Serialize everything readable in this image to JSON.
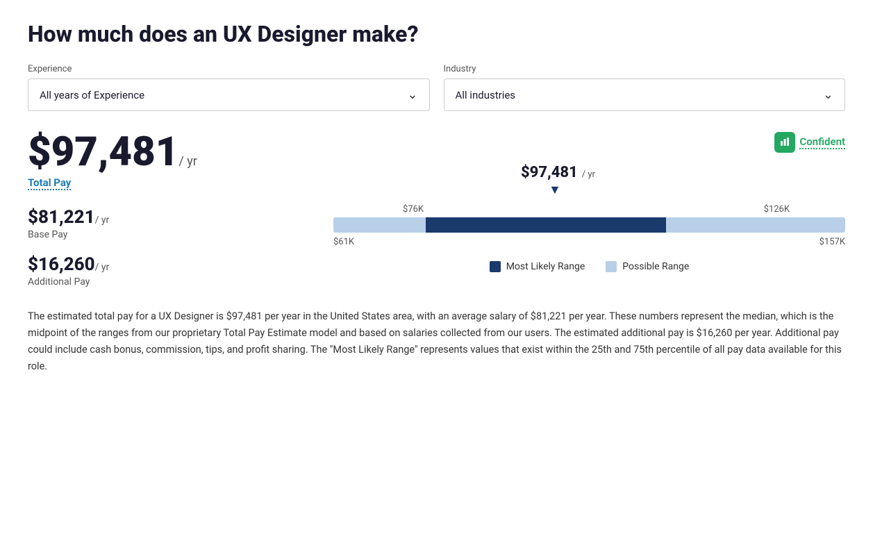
{
  "page": {
    "title": "How much does an UX Designer make?"
  },
  "filters": {
    "experience_label": "Experience",
    "experience_value": "All years of Experience",
    "industry_label": "Industry",
    "industry_value": "All industries"
  },
  "salary": {
    "total_pay_amount": "$97,481",
    "total_pay_suffix": "/ yr",
    "total_pay_label": "Total Pay",
    "base_pay_amount": "$81,221",
    "base_pay_suffix": "/ yr",
    "base_pay_label": "Base Pay",
    "additional_pay_amount": "$16,260",
    "additional_pay_suffix": "/ yr",
    "additional_pay_label": "Additional Pay",
    "median_amount": "$97,481",
    "median_suffix": "/ yr"
  },
  "chart": {
    "range_low": "$76K",
    "range_high": "$126K",
    "min_label": "$61K",
    "max_label": "$157K"
  },
  "legend": {
    "likely_label": "Most Likely Range",
    "possible_label": "Possible Range"
  },
  "confident": {
    "label": "Confident"
  },
  "description": "The estimated total pay for a UX Designer is $97,481 per year in the United States area, with an average salary of $81,221 per year. These numbers represent the median, which is the midpoint of the ranges from our proprietary Total Pay Estimate model and based on salaries collected from our users. The estimated additional pay is $16,260 per year. Additional pay could include cash bonus, commission, tips, and profit sharing. The \"Most Likely Range\" represents values that exist within the 25th and 75th percentile of all pay data available for this role."
}
